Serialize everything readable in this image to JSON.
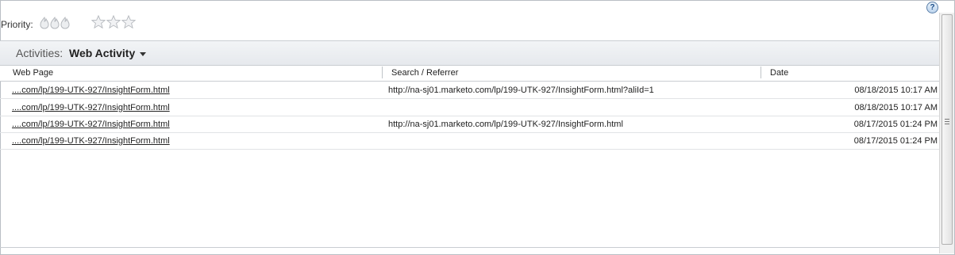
{
  "help": {
    "label": "?"
  },
  "priority": {
    "label": "Priority:",
    "icons": [
      "flame-icon",
      "flame-icon",
      "flame-icon"
    ],
    "stars": [
      "star-icon",
      "star-icon",
      "star-icon"
    ]
  },
  "activities": {
    "label": "Activities:",
    "selected": "Web Activity"
  },
  "table": {
    "columns": [
      "Web Page",
      "Search / Referrer",
      "Date"
    ],
    "rows": [
      {
        "page": "....com/lp/199-UTK-927/InsightForm.html",
        "referrer": "http://na-sj01.marketo.com/lp/199-UTK-927/InsightForm.html?aliId=1",
        "date": "08/18/2015 10:17 AM"
      },
      {
        "page": "....com/lp/199-UTK-927/InsightForm.html",
        "referrer": "",
        "date": "08/18/2015 10:17 AM"
      },
      {
        "page": "....com/lp/199-UTK-927/InsightForm.html",
        "referrer": "http://na-sj01.marketo.com/lp/199-UTK-927/InsightForm.html",
        "date": "08/17/2015 01:24 PM"
      },
      {
        "page": "....com/lp/199-UTK-927/InsightForm.html",
        "referrer": "",
        "date": "08/17/2015 01:24 PM"
      }
    ]
  },
  "colors": {
    "accent": "#1d4f8a",
    "border": "#c9cdd2"
  }
}
